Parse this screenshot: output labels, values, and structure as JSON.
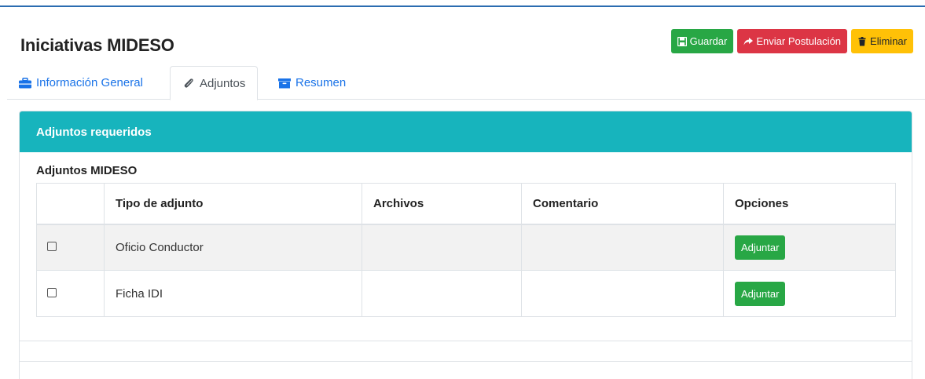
{
  "page": {
    "title": "Iniciativas MIDESO"
  },
  "actions": {
    "save_label": "Guardar",
    "submit_label": "Enviar Postulación",
    "delete_label": "Eliminar"
  },
  "tabs": [
    {
      "label": "Información General",
      "icon": "briefcase-icon",
      "active": false
    },
    {
      "label": "Adjuntos",
      "icon": "paperclip-icon",
      "active": true
    },
    {
      "label": "Resumen",
      "icon": "archive-icon",
      "active": false
    }
  ],
  "card": {
    "header": "Adjuntos requeridos",
    "subtitle": "Adjuntos MIDESO",
    "columns": [
      "",
      "Tipo de adjunto",
      "Archivos",
      "Comentario",
      "Opciones"
    ],
    "rows": [
      {
        "checked": false,
        "tipo": "Oficio Conductor",
        "archivos": "",
        "comentario": "",
        "action": "Adjuntar"
      },
      {
        "checked": false,
        "tipo": "Ficha IDI",
        "archivos": "",
        "comentario": "",
        "action": "Adjuntar"
      }
    ]
  },
  "colors": {
    "accent": "#17b4bd",
    "success": "#28a745",
    "danger": "#dc3545",
    "warning": "#ffc107",
    "link": "#1a73e8"
  }
}
